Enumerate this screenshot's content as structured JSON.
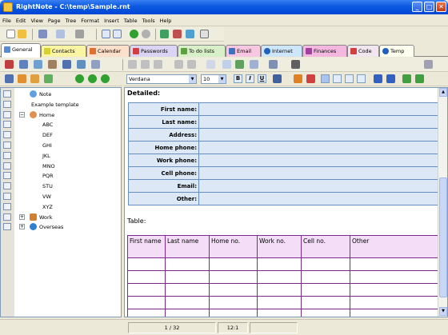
{
  "window": {
    "title": "RightNote - C:\\temp\\Sample.rnt",
    "min": "_",
    "max": "□",
    "close": "✕"
  },
  "menu": [
    "File",
    "Edit",
    "View",
    "Page",
    "Tree",
    "Format",
    "Insert",
    "Table",
    "Tools",
    "Help"
  ],
  "tabs": [
    {
      "label": "General",
      "color": "#5a8bd0"
    },
    {
      "label": "Contacts",
      "color": "#d8d030",
      "bg": "#fbf4a2"
    },
    {
      "label": "Calendar",
      "color": "#e07030",
      "bg": "#fde0cc"
    },
    {
      "label": "Passwords",
      "color": "#d04040",
      "bg": "#dcd4f4"
    },
    {
      "label": "To do lists",
      "color": "#60a040",
      "bg": "#d8f0c8"
    },
    {
      "label": "Email",
      "color": "#4070c0",
      "bg": "#f8c8e0"
    },
    {
      "label": "Internet",
      "color": "#2060c0",
      "bg": "#cde6fb"
    },
    {
      "label": "Finances",
      "color": "#a040a0",
      "bg": "#f4b8e0"
    },
    {
      "label": "Code",
      "color": "#d04040",
      "bg": "#f0e6ee"
    },
    {
      "label": "Temp",
      "color": "#2060c0",
      "bg": "#fffff0"
    }
  ],
  "font_combo": {
    "name": "Verdana",
    "size": "10"
  },
  "format_buttons": {
    "bold": "B",
    "italic": "I",
    "underline": "U"
  },
  "tree": {
    "root": {
      "label": "Note",
      "selected": true
    },
    "items": [
      {
        "label": "Example template"
      },
      {
        "label": "Home",
        "expanded": true
      },
      {
        "label": "ABC"
      },
      {
        "label": "DEF"
      },
      {
        "label": "GHI"
      },
      {
        "label": "JKL"
      },
      {
        "label": "MNO"
      },
      {
        "label": "PQR"
      },
      {
        "label": "STU"
      },
      {
        "label": "VW"
      },
      {
        "label": "XYZ"
      },
      {
        "label": "Work"
      },
      {
        "label": "Overseas"
      }
    ]
  },
  "editor": {
    "detail_heading": "Detailed:",
    "detail_fields": [
      "First name:",
      "Last name:",
      "Address:",
      "Home phone:",
      "Work phone:",
      "Cell phone:",
      "Email:",
      "Other:"
    ],
    "table_heading": "Table:",
    "table_columns": [
      "First name",
      "Last name",
      "Home no.",
      "Work no.",
      "Cell no.",
      "Other"
    ],
    "table_rows": 5
  },
  "status": {
    "page": "1 / 32",
    "position": "12:1"
  }
}
